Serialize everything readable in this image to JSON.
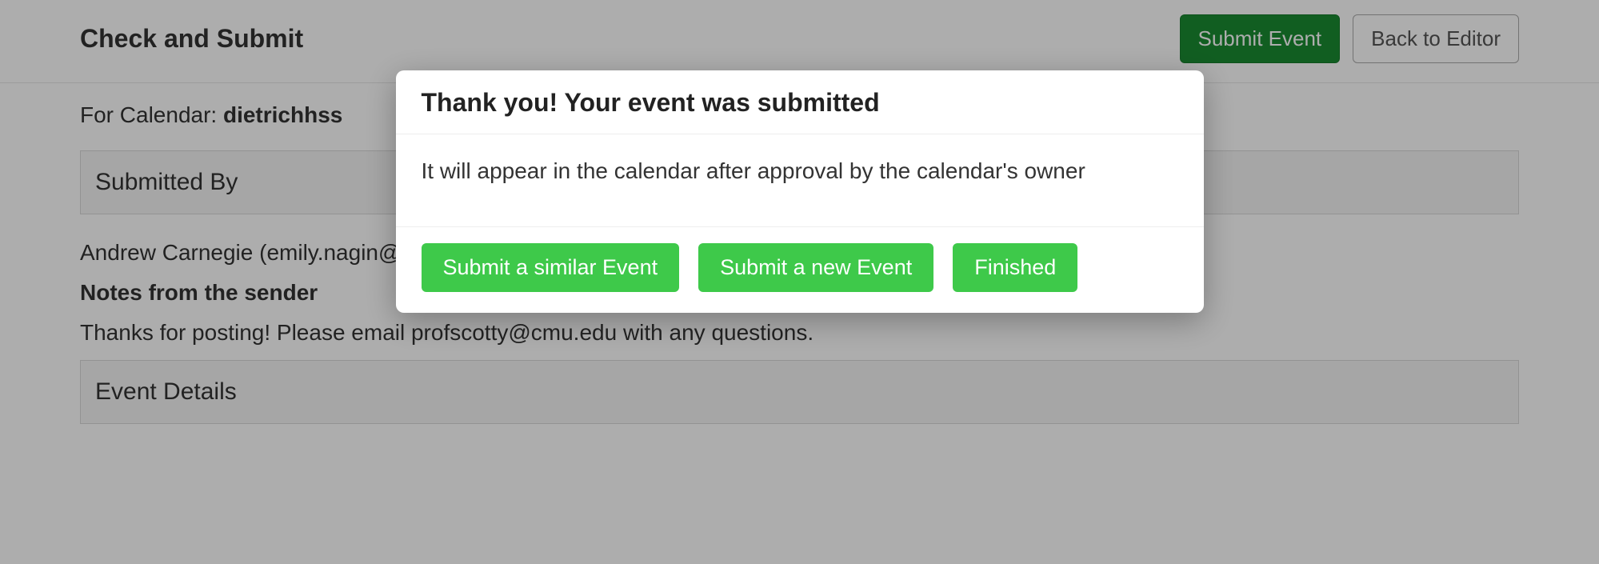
{
  "header": {
    "page_title": "Check and Submit",
    "submit_button": "Submit Event",
    "back_button": "Back to Editor"
  },
  "for_calendar_label": "For Calendar:",
  "for_calendar_value": "dietrichhss",
  "sections": {
    "submitted_by_heading": "Submitted By",
    "submitted_by_value": "Andrew Carnegie (emily.nagin@",
    "notes_label": "Notes from the sender",
    "notes_value": "Thanks for posting! Please email profscotty@cmu.edu with any questions.",
    "event_details_heading": "Event Details"
  },
  "modal": {
    "title": "Thank you! Your event was submitted",
    "body": "It will appear in the calendar after approval by the calendar's owner",
    "buttons": {
      "similar": "Submit a similar Event",
      "new": "Submit a new Event",
      "finished": "Finished"
    }
  }
}
